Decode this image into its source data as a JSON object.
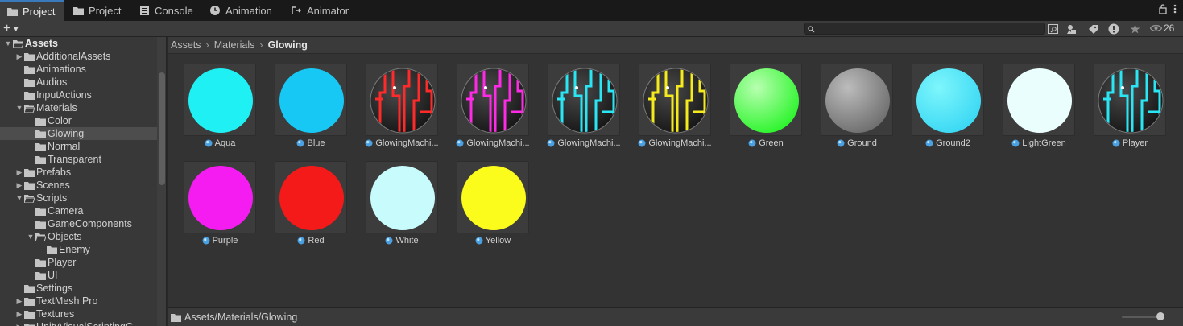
{
  "tabs": [
    {
      "label": "Project",
      "icon": "folder-icon",
      "active": true
    },
    {
      "label": "Project",
      "icon": "folder-icon",
      "active": false
    },
    {
      "label": "Console",
      "icon": "console-icon",
      "active": false
    },
    {
      "label": "Animation",
      "icon": "clock-icon",
      "active": false
    },
    {
      "label": "Animator",
      "icon": "animator-icon",
      "active": false
    }
  ],
  "toolbar": {
    "create_label": "+",
    "search_value": "",
    "hidden_count": "26"
  },
  "tree": [
    {
      "label": "Assets",
      "depth": 0,
      "expanded": true,
      "arrow": true,
      "bold": true
    },
    {
      "label": "AdditionalAssets",
      "depth": 1,
      "arrow": true,
      "expanded": false
    },
    {
      "label": "Animations",
      "depth": 1,
      "arrow": false
    },
    {
      "label": "Audios",
      "depth": 1,
      "arrow": false
    },
    {
      "label": "InputActions",
      "depth": 1,
      "arrow": false
    },
    {
      "label": "Materials",
      "depth": 1,
      "arrow": true,
      "expanded": true
    },
    {
      "label": "Color",
      "depth": 2,
      "arrow": false
    },
    {
      "label": "Glowing",
      "depth": 2,
      "arrow": false,
      "selected": true
    },
    {
      "label": "Normal",
      "depth": 2,
      "arrow": false
    },
    {
      "label": "Transparent",
      "depth": 2,
      "arrow": false
    },
    {
      "label": "Prefabs",
      "depth": 1,
      "arrow": true,
      "expanded": false
    },
    {
      "label": "Scenes",
      "depth": 1,
      "arrow": true,
      "expanded": false
    },
    {
      "label": "Scripts",
      "depth": 1,
      "arrow": true,
      "expanded": true
    },
    {
      "label": "Camera",
      "depth": 2,
      "arrow": false
    },
    {
      "label": "GameComponents",
      "depth": 2,
      "arrow": false
    },
    {
      "label": "Objects",
      "depth": 2,
      "arrow": true,
      "expanded": true
    },
    {
      "label": "Enemy",
      "depth": 3,
      "arrow": false
    },
    {
      "label": "Player",
      "depth": 2,
      "arrow": false
    },
    {
      "label": "UI",
      "depth": 2,
      "arrow": false
    },
    {
      "label": "Settings",
      "depth": 1,
      "arrow": false
    },
    {
      "label": "TextMesh Pro",
      "depth": 1,
      "arrow": true,
      "expanded": false
    },
    {
      "label": "Textures",
      "depth": 1,
      "arrow": true,
      "expanded": false
    },
    {
      "label": "UnityVisualScriptingG...",
      "depth": 1,
      "arrow": true,
      "expanded": false
    }
  ],
  "breadcrumb": [
    "Assets",
    "Materials",
    "Glowing"
  ],
  "assets": [
    {
      "label": "Aqua",
      "kind": "solid",
      "color": "#1ff0f4"
    },
    {
      "label": "Blue",
      "kind": "solid",
      "color": "#18c8f4"
    },
    {
      "label": "GlowingMachi...",
      "kind": "pattern",
      "color": "#ff2a2a"
    },
    {
      "label": "GlowingMachi...",
      "kind": "pattern",
      "color": "#ff2ae6"
    },
    {
      "label": "GlowingMachi...",
      "kind": "pattern",
      "color": "#2ae6f4"
    },
    {
      "label": "GlowingMachi...",
      "kind": "pattern",
      "color": "#f4ea1c"
    },
    {
      "label": "Green",
      "kind": "shaded",
      "color": "#2cf42c",
      "highlight": "#b8ffb0"
    },
    {
      "label": "Ground",
      "kind": "shaded",
      "color": "#6e6e6e",
      "highlight": "#bcbcbc"
    },
    {
      "label": "Ground2",
      "kind": "shaded",
      "color": "#3ad8f4",
      "highlight": "#7ef6fc"
    },
    {
      "label": "LightGreen",
      "kind": "solid",
      "color": "#eafefe"
    },
    {
      "label": "Player",
      "kind": "pattern",
      "color": "#2ae6f4"
    },
    {
      "label": "Purple",
      "kind": "solid",
      "color": "#f41cf0"
    },
    {
      "label": "Red",
      "kind": "solid",
      "color": "#f41a1a"
    },
    {
      "label": "White",
      "kind": "solid",
      "color": "#c8fcfc"
    },
    {
      "label": "Yellow",
      "kind": "solid",
      "color": "#fbfb1c"
    }
  ],
  "status": {
    "path": "Assets/Materials/Glowing"
  },
  "colors": {
    "accent": "#3a79bb",
    "selection": "#4d4d4d"
  }
}
